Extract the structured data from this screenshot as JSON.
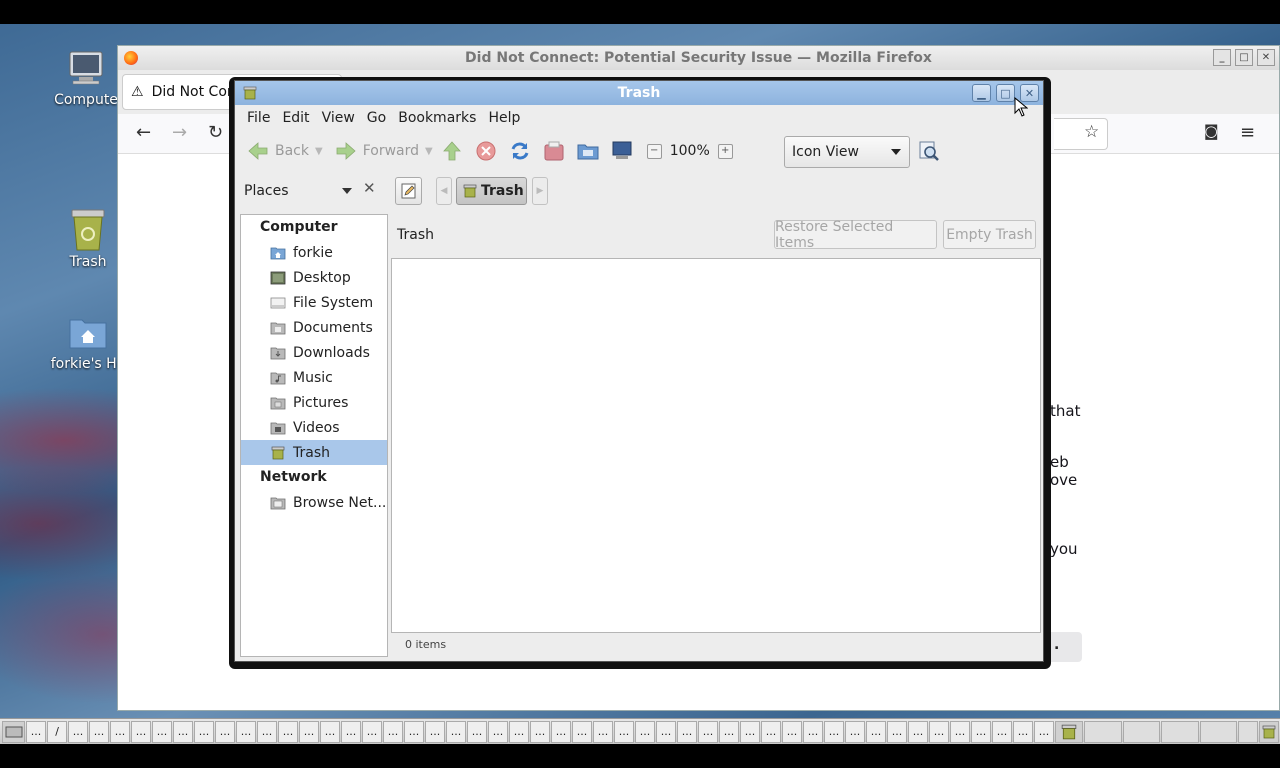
{
  "desktop": {
    "icons": [
      {
        "label": "Compute",
        "icon": "computer-icon"
      },
      {
        "label": "Trash",
        "icon": "trash-icon"
      },
      {
        "label": "forkie's Ho",
        "icon": "home-folder-icon"
      }
    ]
  },
  "firefox": {
    "window_title": "Did Not Connect: Potential Security Issue — Mozilla Firefox",
    "tab_label": "Did Not Con",
    "fragments": [
      "that",
      "eb",
      "ove",
      "you",
      "."
    ]
  },
  "nautilus": {
    "window_title": "Trash",
    "menu": [
      "File",
      "Edit",
      "View",
      "Go",
      "Bookmarks",
      "Help"
    ],
    "toolbar": {
      "back": "Back",
      "forward": "Forward",
      "zoom": "100%",
      "view_mode": "Icon View"
    },
    "sidebar_selector": "Places",
    "breadcrumb": "Trash",
    "sidebar": {
      "computer_header": "Computer",
      "computer_items": [
        "forkie",
        "Desktop",
        "File System",
        "Documents",
        "Downloads",
        "Music",
        "Pictures",
        "Videos",
        "Trash"
      ],
      "network_header": "Network",
      "network_items": [
        "Browse Net..."
      ]
    },
    "content": {
      "title": "Trash",
      "restore_button": "Restore Selected Items",
      "empty_button": "Empty Trash"
    },
    "status": "0 items"
  },
  "taskbar": {
    "cells": [
      "...",
      "/",
      "...",
      "...",
      "...",
      "...",
      "...",
      "...",
      "...",
      "...",
      "...",
      "...",
      "...",
      "...",
      "...",
      "...",
      "...",
      "...",
      "...",
      "...",
      "...",
      "...",
      "...",
      "...",
      "...",
      "...",
      "...",
      "...",
      "...",
      "...",
      "...",
      "...",
      "...",
      "...",
      "...",
      "...",
      "...",
      "...",
      "...",
      "...",
      "...",
      "...",
      "...",
      "...",
      "...",
      "...",
      "...",
      "...",
      "..."
    ]
  },
  "colors": {
    "titlebar": "#8db3de",
    "selection": "#a9c7ea",
    "trash_icon": "#a8b24a"
  }
}
